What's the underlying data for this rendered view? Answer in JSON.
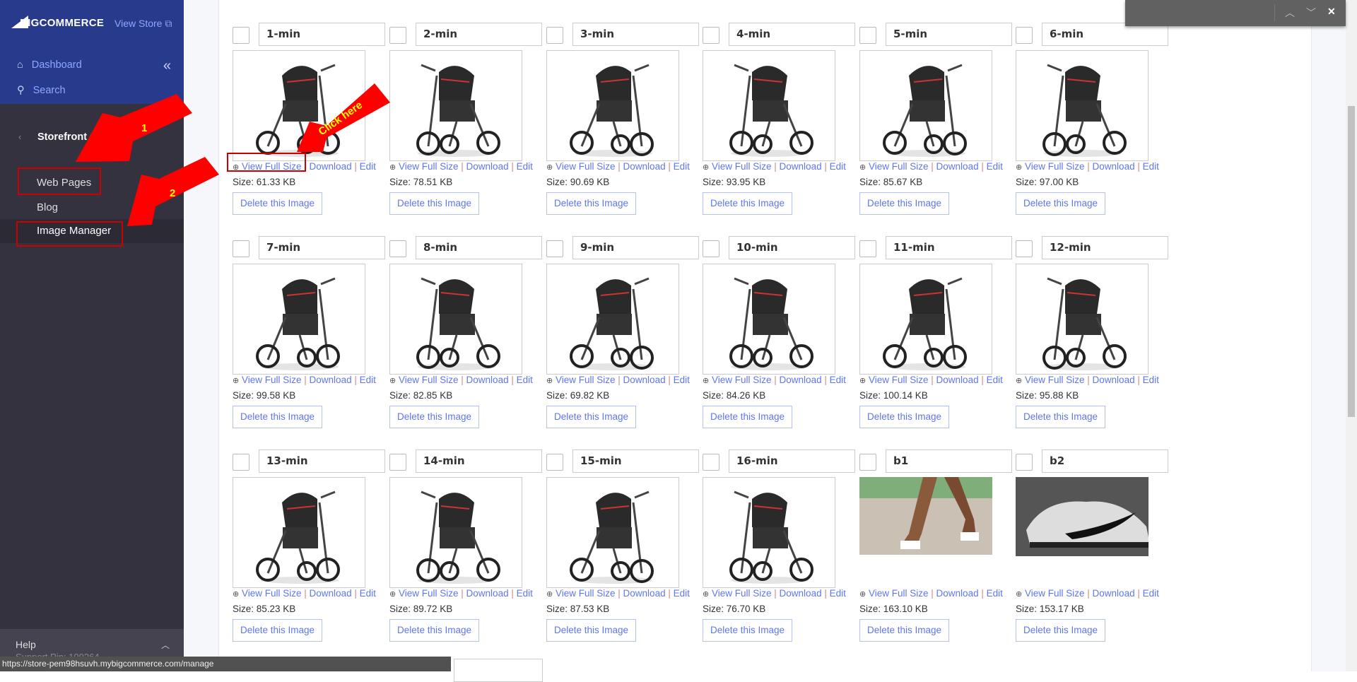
{
  "sidebar": {
    "logo": "BIGCOMMERCE",
    "view_store": "View Store",
    "dashboard": "Dashboard",
    "search": "Search",
    "section": "Storefront Content",
    "items": [
      "Web Pages",
      "Blog",
      "Image Manager"
    ],
    "active": "Image Manager",
    "help": "Help",
    "support_pin": "Support Pin: 100264"
  },
  "links": {
    "view": "View Full Size",
    "download": "Download",
    "edit": "Edit",
    "delete": "Delete this Image"
  },
  "images": [
    {
      "name": "1-min",
      "size": "Size: 61.33 KB",
      "type": "stroller"
    },
    {
      "name": "2-min",
      "size": "Size: 78.51 KB",
      "type": "stroller"
    },
    {
      "name": "3-min",
      "size": "Size: 90.69 KB",
      "type": "stroller"
    },
    {
      "name": "4-min",
      "size": "Size: 93.95 KB",
      "type": "stroller"
    },
    {
      "name": "5-min",
      "size": "Size: 85.67 KB",
      "type": "stroller"
    },
    {
      "name": "6-min",
      "size": "Size: 97.00 KB",
      "type": "stroller"
    },
    {
      "name": "7-min",
      "size": "Size: 99.58 KB",
      "type": "stroller"
    },
    {
      "name": "8-min",
      "size": "Size: 82.85 KB",
      "type": "stroller"
    },
    {
      "name": "9-min",
      "size": "Size: 69.82 KB",
      "type": "stroller"
    },
    {
      "name": "10-min",
      "size": "Size: 84.26 KB",
      "type": "stroller"
    },
    {
      "name": "11-min",
      "size": "Size: 100.14 KB",
      "type": "stroller"
    },
    {
      "name": "12-min",
      "size": "Size: 95.88 KB",
      "type": "stroller"
    },
    {
      "name": "13-min",
      "size": "Size: 85.23 KB",
      "type": "stroller"
    },
    {
      "name": "14-min",
      "size": "Size: 89.72 KB",
      "type": "stroller"
    },
    {
      "name": "15-min",
      "size": "Size: 87.53 KB",
      "type": "stroller"
    },
    {
      "name": "16-min",
      "size": "Size: 76.70 KB",
      "type": "stroller"
    },
    {
      "name": "b1",
      "size": "Size: 163.10 KB",
      "type": "photo-legs"
    },
    {
      "name": "b2",
      "size": "Size: 153.17 KB",
      "type": "photo-shoe"
    }
  ],
  "annotations": {
    "arrow1": "1",
    "arrow2": "2",
    "click": "Click here",
    "color": "#ff0000"
  },
  "status_url": "https://store-pem98hsuvh.mybigcommerce.com/manage",
  "colors": {
    "sidebar_top": "#283a8c",
    "sidebar": "#34323f",
    "link": "#5f76f2"
  }
}
